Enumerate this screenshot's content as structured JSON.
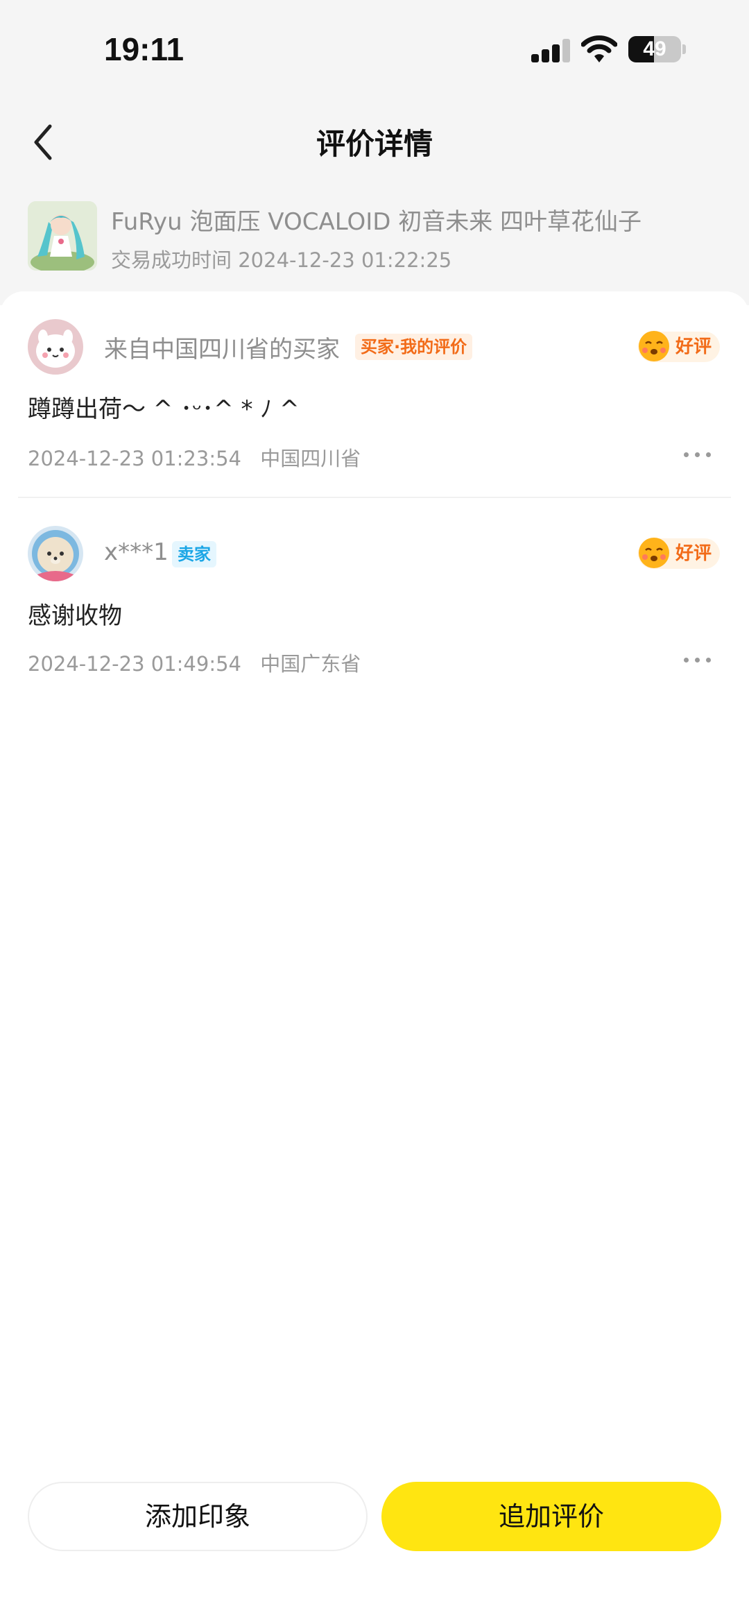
{
  "status_bar": {
    "time": "19:11",
    "battery": "49",
    "battery_level": 0.49
  },
  "nav": {
    "title": "评价详情"
  },
  "product": {
    "title": "FuRyu 泡面压 VOCALOID 初音未来 四叶草花仙子",
    "trade_time": "交易成功时间 2024-12-23 01:22:25"
  },
  "reviews": [
    {
      "user": "来自中国四川省的买家",
      "tag": "买家·我的评价",
      "rating": "好评",
      "content": "蹲蹲出荷～ ^ ･ᵕ･^ * ﾉ ^",
      "time": "2024-12-23 01:23:54",
      "location": "中国四川省"
    },
    {
      "user": "x***1",
      "tag": "卖家",
      "rating": "好评",
      "content": "感谢收物",
      "time": "2024-12-23 01:49:54",
      "location": "中国广东省"
    }
  ],
  "actions": {
    "add_impression": "添加印象",
    "append_review": "追加评价"
  },
  "colors": {
    "accent_yellow": "#ffe511",
    "buyer_tag": "#f26b18",
    "seller_tag": "#1ba6e6"
  }
}
